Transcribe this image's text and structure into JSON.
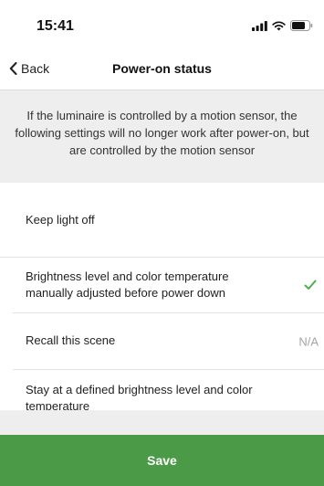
{
  "status_bar": {
    "time": "15:41",
    "icons": [
      "cellular-signal-icon",
      "wifi-icon",
      "battery-icon"
    ]
  },
  "nav": {
    "back_label": "Back",
    "title": "Power-on status"
  },
  "info": {
    "lines": [
      "If the luminaire is controlled by a motion sensor, the",
      "following settings will no longer work after power-on, but",
      "are controlled by the motion sensor"
    ]
  },
  "options": [
    {
      "label": "Keep light off",
      "selected": false,
      "value": ""
    },
    {
      "label": "Brightness level and color temperature manually adjusted before power down",
      "selected": true,
      "value": ""
    },
    {
      "label": "Recall this scene",
      "selected": false,
      "value": "N/A"
    },
    {
      "label": "Stay at a defined brightness level and color temperature",
      "selected": false,
      "value": ""
    }
  ],
  "save_label": "Save",
  "colors": {
    "accent": "#4b9a47",
    "checkmark": "#4caf50",
    "info_background": "#eeeeee",
    "muted_text": "#a5a5a5"
  }
}
